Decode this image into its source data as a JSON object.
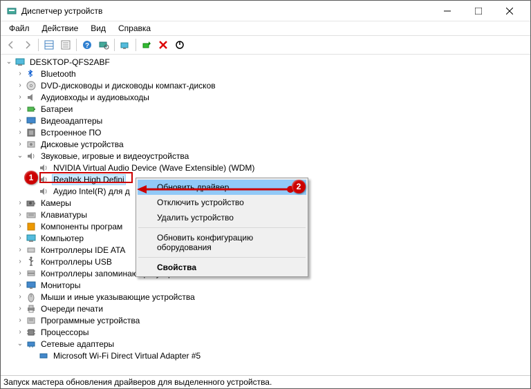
{
  "window": {
    "title": "Диспетчер устройств"
  },
  "menu": {
    "file": "Файл",
    "action": "Действие",
    "view": "Вид",
    "help": "Справка"
  },
  "tree": {
    "root": "DESKTOP-QFS2ABF",
    "items": [
      "Bluetooth",
      "DVD-дисководы и дисководы компакт-дисков",
      "Аудиовходы и аудиовыходы",
      "Батареи",
      "Видеоадаптеры",
      "Встроенное ПО",
      "Дисковые устройства",
      "Звуковые, игровые и видеоустройства",
      "Камеры",
      "Клавиатуры",
      "Компоненты програм",
      "Компьютер",
      "Контроллеры IDE ATA",
      "Контроллеры USB",
      "Контроллеры запоминающих устройств",
      "Мониторы",
      "Мыши и иные указывающие устройства",
      "Очереди печати",
      "Программные устройства",
      "Процессоры",
      "Сетевые адаптеры"
    ],
    "audio_children": [
      "NVIDIA Virtual Audio Device (Wave Extensible) (WDM)",
      "Realtek High Defini",
      "Аудио Intel(R) для д"
    ],
    "network_child": "Microsoft Wi-Fi Direct Virtual Adapter #5"
  },
  "context_menu": {
    "update_driver": "Обновить драйвер",
    "disable": "Отключить устройство",
    "uninstall": "Удалить устройство",
    "scan": "Обновить конфигурацию оборудования",
    "properties": "Свойства"
  },
  "status": "Запуск мастера обновления драйверов для выделенного устройства."
}
